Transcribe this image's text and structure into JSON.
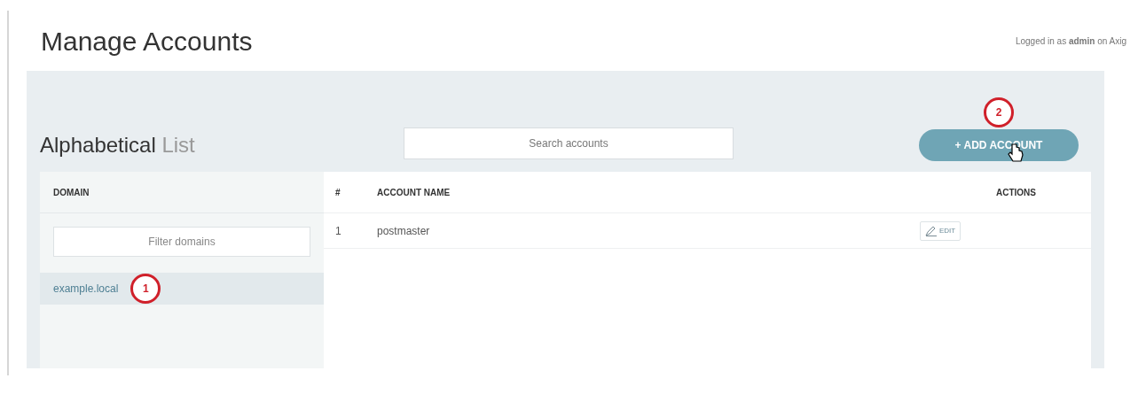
{
  "page_title": "Manage Accounts",
  "login_info": "Logged in as **admin** on Axig",
  "list_heading": {
    "bold": "Alphabetical",
    "light": "List"
  },
  "search": {
    "placeholder": "Search accounts"
  },
  "add_button": {
    "label": "+ ADD ACCOUNT",
    "marker": "2"
  },
  "domain_column": {
    "heading": "DOMAIN",
    "filter": {
      "placeholder": "Filter domains"
    },
    "domains": [
      {
        "name": "example.local",
        "selected": true,
        "marker": "1"
      }
    ]
  },
  "table": {
    "columns": [
      "#",
      "ACCOUNT NAME",
      "ACTIONS"
    ],
    "rows": [
      {
        "number": "1",
        "name": "postmaster",
        "action": "EDIT"
      }
    ]
  }
}
